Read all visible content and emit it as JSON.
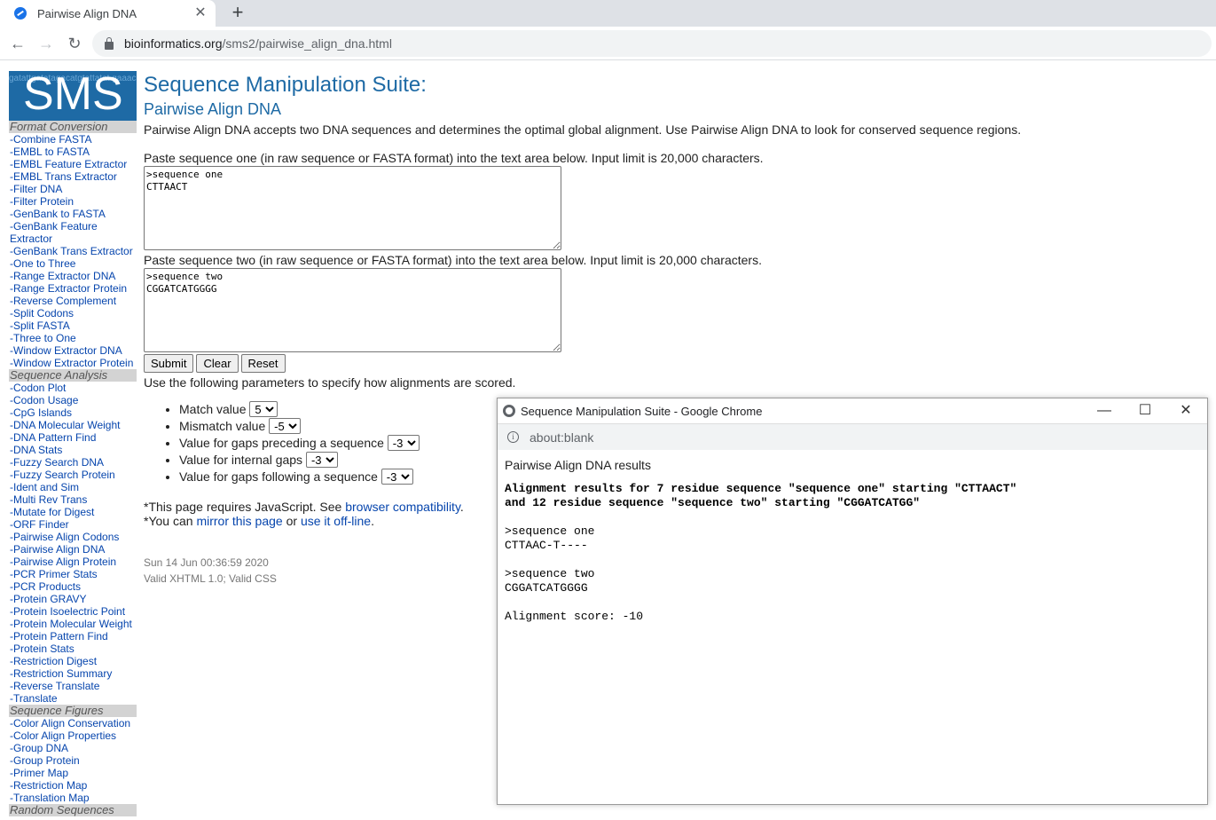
{
  "browser": {
    "tab_title": "Pairwise Align DNA",
    "tab_close": "✕",
    "new_tab": "+",
    "url_host": "bioinformatics.org",
    "url_path": "/sms2/pairwise_align_dna.html",
    "back": "←",
    "forward": "→",
    "reload": "↻"
  },
  "logo": {
    "text": "SMS",
    "bg_text": "gatattgatatagacatgtattatat gaaacagatagcagacataaccggg cagacctattagaagcagatagatta cacaagacatacagacagcagatataa"
  },
  "sidebar": {
    "sections": [
      {
        "title": "Format Conversion",
        "items": [
          "-Combine FASTA",
          "-EMBL to FASTA",
          "-EMBL Feature Extractor",
          "-EMBL Trans Extractor",
          "-Filter DNA",
          "-Filter Protein",
          "-GenBank to FASTA",
          "-GenBank Feature Extractor",
          "-GenBank Trans Extractor",
          "-One to Three",
          "-Range Extractor DNA",
          "-Range Extractor Protein",
          "-Reverse Complement",
          "-Split Codons",
          "-Split FASTA",
          "-Three to One",
          "-Window Extractor DNA",
          "-Window Extractor Protein"
        ]
      },
      {
        "title": "Sequence Analysis",
        "items": [
          "-Codon Plot",
          "-Codon Usage",
          "-CpG Islands",
          "-DNA Molecular Weight",
          "-DNA Pattern Find",
          "-DNA Stats",
          "-Fuzzy Search DNA",
          "-Fuzzy Search Protein",
          "-Ident and Sim",
          "-Multi Rev Trans",
          "-Mutate for Digest",
          "-ORF Finder",
          "-Pairwise Align Codons",
          "-Pairwise Align DNA",
          "-Pairwise Align Protein",
          "-PCR Primer Stats",
          "-PCR Products",
          "-Protein GRAVY",
          "-Protein Isoelectric Point",
          "-Protein Molecular Weight",
          "-Protein Pattern Find",
          "-Protein Stats",
          "-Restriction Digest",
          "-Restriction Summary",
          "-Reverse Translate",
          "-Translate"
        ]
      },
      {
        "title": "Sequence Figures",
        "items": [
          "-Color Align Conservation",
          "-Color Align Properties",
          "-Group DNA",
          "-Group Protein",
          "-Primer Map",
          "-Restriction Map",
          "-Translation Map"
        ]
      },
      {
        "title": "Random Sequences",
        "items": []
      }
    ]
  },
  "main": {
    "title": "Sequence Manipulation Suite:",
    "subtitle": "Pairwise Align DNA",
    "description": "Pairwise Align DNA accepts two DNA sequences and determines the optimal global alignment. Use Pairwise Align DNA to look for conserved sequence regions.",
    "seq1_label": "Paste sequence one (in raw sequence or FASTA format) into the text area below. Input limit is 20,000 characters.",
    "seq1_value": ">sequence one\nCTTAACT",
    "seq2_label": "Paste sequence two (in raw sequence or FASTA format) into the text area below. Input limit is 20,000 characters.",
    "seq2_value": ">sequence two\nCGGATCATGGGG",
    "submit": "Submit",
    "clear": "Clear",
    "reset": "Reset",
    "params_intro": "Use the following parameters to specify how alignments are scored.",
    "params": [
      {
        "label": "Match value",
        "value": "5"
      },
      {
        "label": "Mismatch value",
        "value": "-5"
      },
      {
        "label": "Value for gaps preceding a sequence",
        "value": "-3"
      },
      {
        "label": "Value for internal gaps",
        "value": "-3"
      },
      {
        "label": "Value for gaps following a sequence",
        "value": "-3"
      }
    ],
    "note1_prefix": "*This page requires JavaScript. See ",
    "note1_link": "browser compatibility",
    "note1_suffix": ".",
    "note2_prefix": "*You can ",
    "note2_link1": "mirror this page",
    "note2_mid": " or ",
    "note2_link2": "use it off-line",
    "note2_suffix": ".",
    "timestamp": "Sun 14 Jun 00:36:59 2020",
    "valid": "Valid XHTML 1.0; Valid CSS"
  },
  "popup": {
    "window_title": "Sequence Manipulation Suite - Google Chrome",
    "minimize": "—",
    "maximize": "☐",
    "close": "✕",
    "url": "about:blank",
    "results_title": "Pairwise Align DNA results",
    "summary_line1": "Alignment results for 7 residue sequence \"sequence one\" starting \"CTTAACT\"",
    "summary_line2": "and 12 residue sequence \"sequence two\" starting \"CGGATCATGG\"",
    "seq1_header": ">sequence one",
    "seq1_aligned": "CTTAAC-T----",
    "seq2_header": ">sequence two",
    "seq2_aligned": "CGGATCATGGGG",
    "score": "Alignment score: -10"
  }
}
